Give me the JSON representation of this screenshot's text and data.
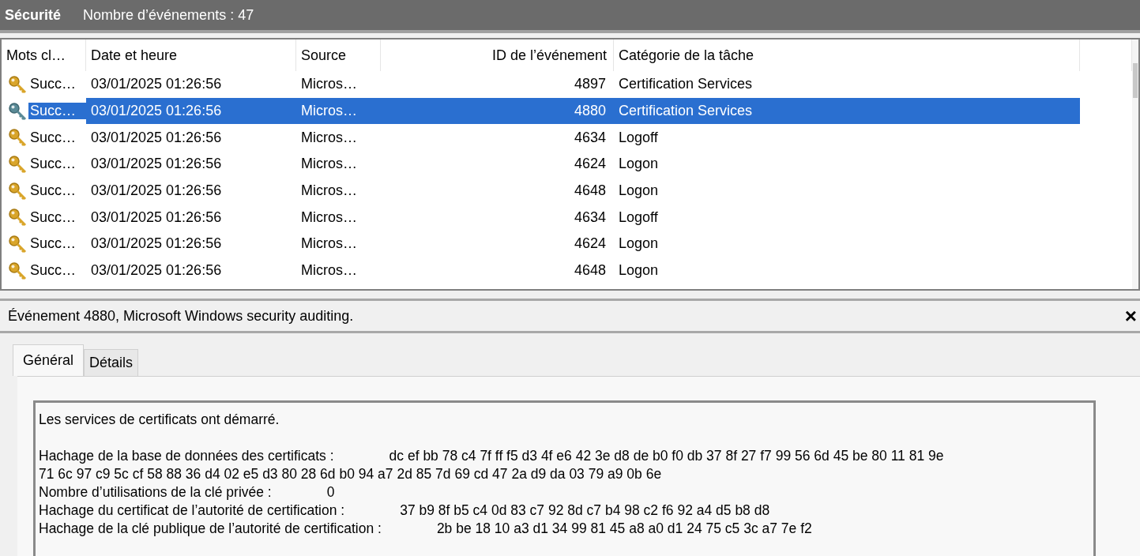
{
  "header": {
    "title": "Sécurité",
    "count": "Nombre d’événements : 47"
  },
  "table": {
    "columns": [
      "Mots cl…",
      "Date et heure",
      "Source",
      "ID de l’événement",
      "Catégorie de la tâche"
    ],
    "rows": [
      {
        "keywords": "Succ…",
        "date": "03/01/2025 01:26:56",
        "source": "Micros…",
        "id": "4897",
        "category": "Certification Services",
        "selected": false
      },
      {
        "keywords": "Succ…",
        "date": "03/01/2025 01:26:56",
        "source": "Micros…",
        "id": "4880",
        "category": "Certification Services",
        "selected": true
      },
      {
        "keywords": "Succ…",
        "date": "03/01/2025 01:26:56",
        "source": "Micros…",
        "id": "4634",
        "category": "Logoff",
        "selected": false
      },
      {
        "keywords": "Succ…",
        "date": "03/01/2025 01:26:56",
        "source": "Micros…",
        "id": "4624",
        "category": "Logon",
        "selected": false
      },
      {
        "keywords": "Succ…",
        "date": "03/01/2025 01:26:56",
        "source": "Micros…",
        "id": "4648",
        "category": "Logon",
        "selected": false
      },
      {
        "keywords": "Succ…",
        "date": "03/01/2025 01:26:56",
        "source": "Micros…",
        "id": "4634",
        "category": "Logoff",
        "selected": false
      },
      {
        "keywords": "Succ…",
        "date": "03/01/2025 01:26:56",
        "source": "Micros…",
        "id": "4624",
        "category": "Logon",
        "selected": false
      },
      {
        "keywords": "Succ…",
        "date": "03/01/2025 01:26:56",
        "source": "Micros…",
        "id": "4648",
        "category": "Logon",
        "selected": false
      }
    ]
  },
  "details": {
    "title": "Événement 4880, Microsoft Windows security auditing.",
    "close": "×",
    "tabs": [
      {
        "label": "Général",
        "selected": true
      },
      {
        "label": "Détails",
        "selected": false
      }
    ],
    "message": "Les services de certificats ont démarré.",
    "fields": [
      {
        "label": "Hachage de la base de données des certificats :",
        "value": "dc ef bb 78 c4 7f ff f5 d3 4f e6 42 3e d8 de b0 f0 db 37 8f 27 f7 99 56 6d 45 be 80 11 81 9e",
        "continuation": "71 6c 97 c9 5c cf 58 88 36 d4 02 e5 d3 80 28 6d b0 94 a7 2d 85 7d 69 cd 47 2a d9 da 03 79 a9 0b 6e"
      },
      {
        "label": "Nombre d’utilisations de la clé privée :",
        "value": "0"
      },
      {
        "label": "Hachage du certificat de l’autorité de certification :",
        "value": "37 b9 8f b5 c4 0d 83 c7 92 8d c7 b4 98 c2 f6 92 a4 d5 b8 d8"
      },
      {
        "label": "Hachage de la clé publique de l’autorité de certification :",
        "value": "2b be 18 10 a3 d1 34 99 81 45 a8 a0 d1 24 75 c5 3c a7 7e f2"
      }
    ]
  }
}
